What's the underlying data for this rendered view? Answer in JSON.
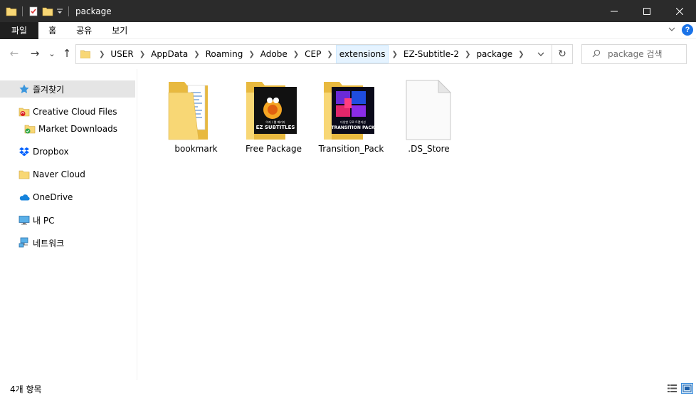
{
  "window": {
    "title": "package",
    "minimize_glyph": "─",
    "maximize_glyph": "☐",
    "close_glyph": "✕"
  },
  "ribbon": {
    "tabs": [
      {
        "label": "파일"
      },
      {
        "label": "홈"
      },
      {
        "label": "공유"
      },
      {
        "label": "보기"
      }
    ]
  },
  "nav": {
    "back_glyph": "←",
    "forward_glyph": "→",
    "recent_glyph": "⌄",
    "up_glyph": "↑",
    "refresh_glyph": "↻",
    "breadcrumbs": [
      {
        "label": "USER"
      },
      {
        "label": "AppData"
      },
      {
        "label": "Roaming"
      },
      {
        "label": "Adobe"
      },
      {
        "label": "CEP"
      },
      {
        "label": "extensions"
      },
      {
        "label": "EZ-Subtitle-2"
      },
      {
        "label": "package"
      }
    ],
    "search_placeholder": "package 검색"
  },
  "sidebar": {
    "items": [
      {
        "label": "즐겨찾기",
        "icon": "star-icon"
      },
      {
        "label": "Creative Cloud Files",
        "icon": "creative-cloud-folder-icon"
      },
      {
        "label": "Market Downloads",
        "icon": "market-folder-icon"
      },
      {
        "label": "Dropbox",
        "icon": "dropbox-icon"
      },
      {
        "label": "Naver Cloud",
        "icon": "folder-icon"
      },
      {
        "label": "OneDrive",
        "icon": "onedrive-cloud-icon"
      },
      {
        "label": "내 PC",
        "icon": "pc-monitor-icon"
      },
      {
        "label": "네트워크",
        "icon": "network-icon"
      }
    ]
  },
  "files": [
    {
      "name": "bookmark",
      "icon": "folder-with-documents-icon"
    },
    {
      "name": "Free Package",
      "icon": "folder-ez-subtitles-icon",
      "thumb_text": [
        "이지 / 웹 패키지",
        "EZ SUBTITLES"
      ]
    },
    {
      "name": "Transition_Pack",
      "icon": "folder-transition-pack-icon",
      "thumb_text": [
        "다양한 무료 트랜지션",
        "TRANSITION PACK"
      ]
    },
    {
      "name": ".DS_Store",
      "icon": "blank-file-icon"
    }
  ],
  "status": {
    "item_count": "4개 항목"
  },
  "colors": {
    "titlebar_bg": "#2b2b2b",
    "file_tab_bg": "#1f1f1f",
    "accent_blue": "#1a73e8",
    "selected_bg": "#e5e5e5",
    "highlight_crumb": "#e5f3ff",
    "folder_yellow": "#f8d775"
  }
}
